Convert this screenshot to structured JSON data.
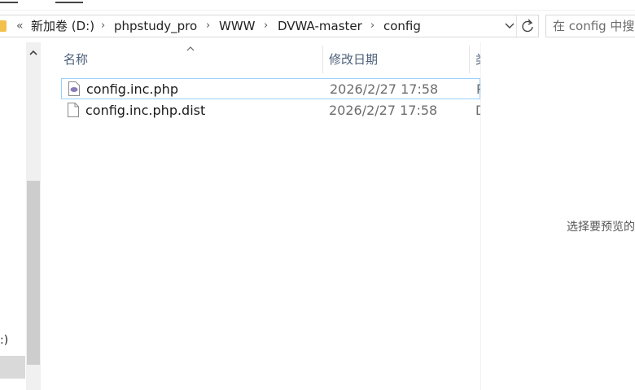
{
  "address_bar": {
    "overflow_chevron": "«",
    "crumbs": [
      "新加卷 (D:)",
      "phpstudy_pro",
      "WWW",
      "DVWA-master",
      "config"
    ],
    "separator": "›",
    "dropdown_icon": "chevron-down-icon",
    "refresh_icon": "refresh-icon"
  },
  "search": {
    "placeholder": "在 config 中搜索"
  },
  "nav_pane": {
    "partial_label": ":)"
  },
  "columns": {
    "name": "名称",
    "date_modified": "修改日期",
    "type_partial": "类"
  },
  "files": [
    {
      "name": "config.inc.php",
      "date": "2026/2/27 17:58",
      "type_partial": "P",
      "icon": "php-file-icon",
      "selected": true
    },
    {
      "name": "config.inc.php.dist",
      "date": "2026/2/27 17:58",
      "type_partial": "D",
      "icon": "blank-file-icon",
      "selected": false
    }
  ],
  "preview": {
    "message": "选择要预览的"
  },
  "colors": {
    "selection_border": "#99d1ff",
    "header_text": "#4c607a",
    "folder_yellow": "#f3c14b"
  }
}
